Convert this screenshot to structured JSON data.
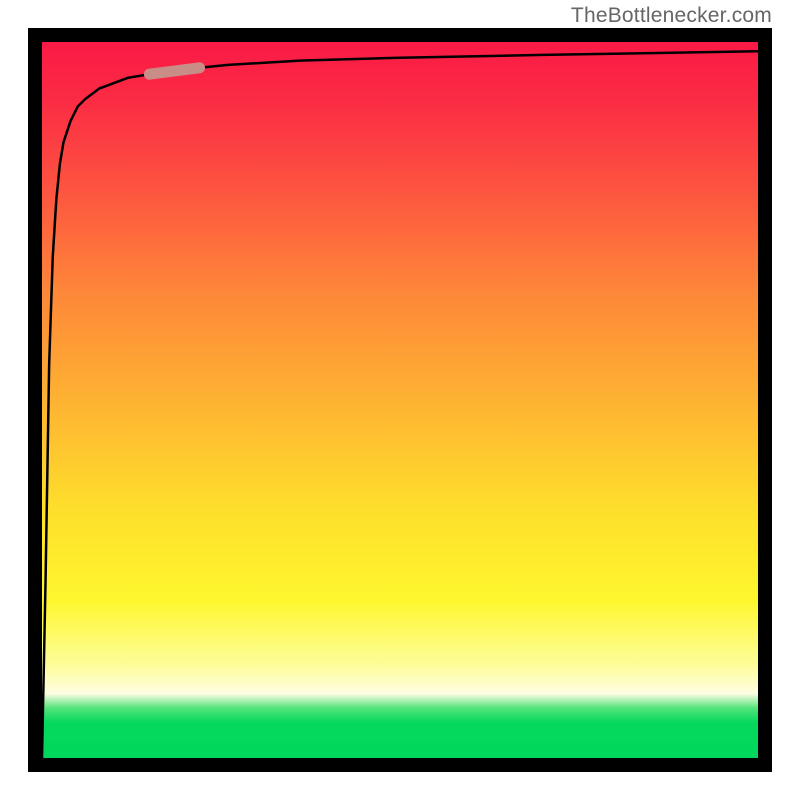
{
  "watermark": {
    "text": "TheBottlenecker.com"
  },
  "chart_data": {
    "type": "line",
    "title": "",
    "xlabel": "",
    "ylabel": "",
    "xlim": [
      0,
      100
    ],
    "ylim": [
      0,
      100
    ],
    "grid": false,
    "legend": false,
    "background": "vertical heat gradient (red top → yellow → green bottom)",
    "series": [
      {
        "name": "main_curve",
        "color": "#000000",
        "x": [
          0,
          0.5,
          1,
          1.5,
          2,
          2.5,
          3,
          4,
          5,
          6,
          8,
          12,
          18,
          26,
          36,
          50,
          70,
          100
        ],
        "values": [
          0,
          25,
          55,
          70,
          78,
          83,
          86,
          89,
          91,
          92,
          93.5,
          95,
          96,
          96.8,
          97.4,
          97.8,
          98.2,
          98.7
        ]
      },
      {
        "name": "highlight_segment",
        "color": "#c98d87",
        "note": "short thicker pale segment overlaying main curve near upper-left",
        "x": [
          15,
          22
        ],
        "values": [
          95.5,
          96.4
        ]
      }
    ]
  }
}
